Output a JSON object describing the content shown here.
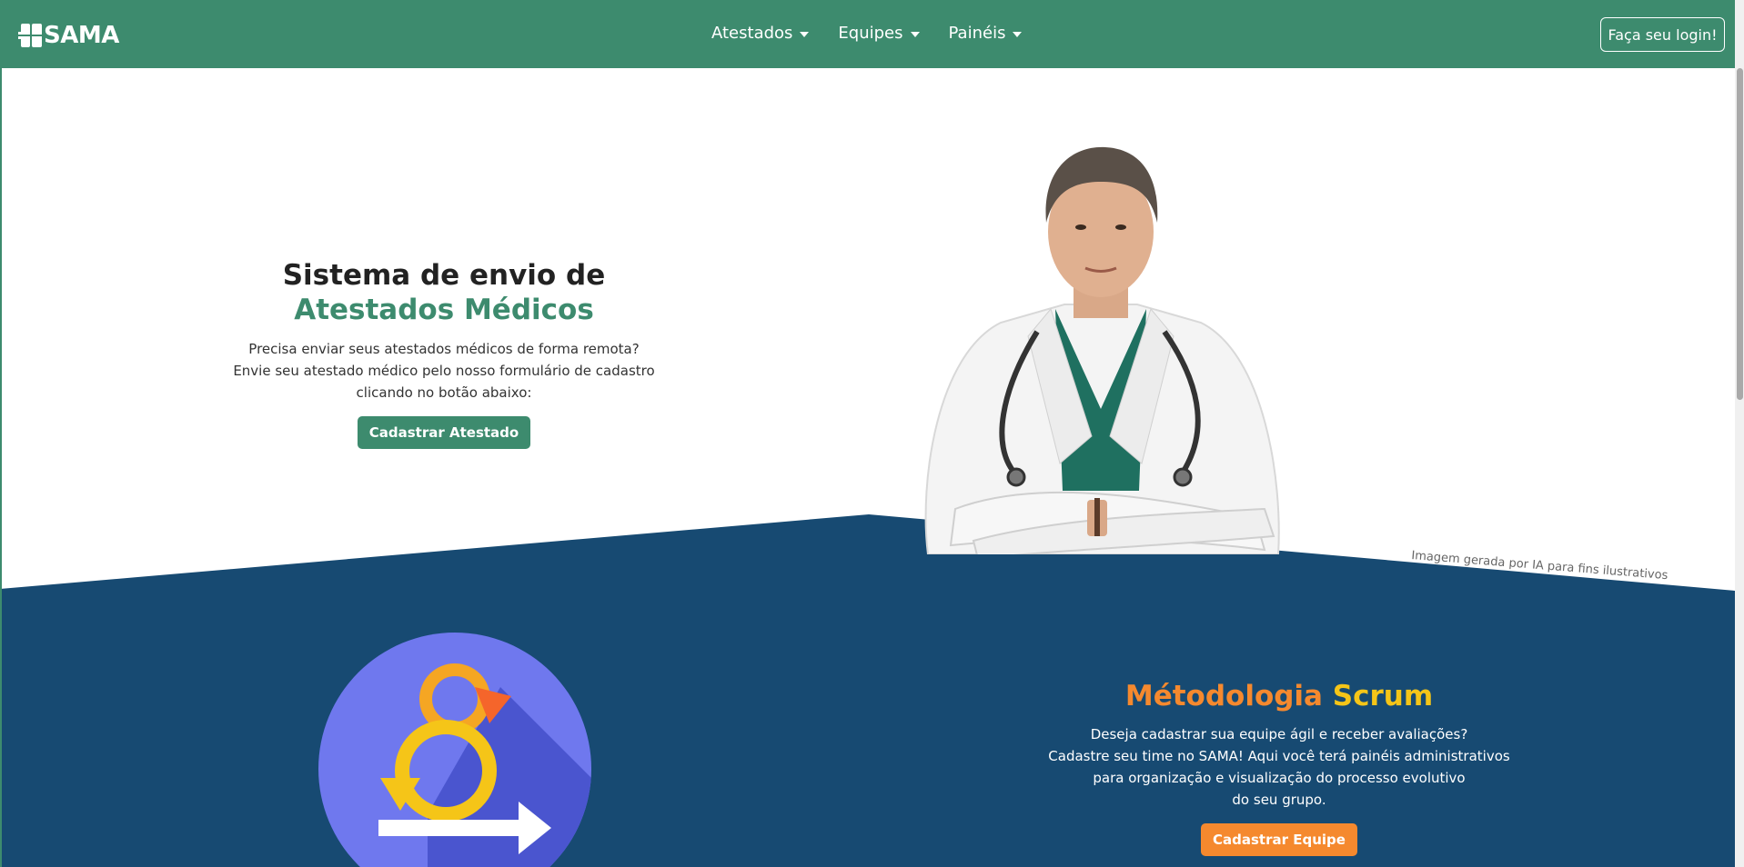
{
  "navbar": {
    "brand": "SAMA",
    "menu": [
      {
        "label": "Atestados"
      },
      {
        "label": "Equipes"
      },
      {
        "label": "Painéis"
      }
    ],
    "login_label": "Faça seu login!"
  },
  "hero": {
    "title_line1": "Sistema de envio de",
    "title_line2": "Atestados Médicos",
    "desc_line1": "Precisa enviar seus atestados médicos de forma remota?",
    "desc_line2": "Envie seu atestado médico pelo nosso formulário de cadastro",
    "desc_line3": "clicando no botão abaixo:",
    "button_label": "Cadastrar Atestado",
    "image_credit": "Imagem gerada por IA para fins ilustrativos"
  },
  "scrum": {
    "title_part1": "Métodologia",
    "title_part2": "Scrum",
    "desc_line1": "Deseja cadastrar sua equipe ágil e receber avaliações?",
    "desc_line2": "Cadastre seu time no SAMA! Aqui você terá painéis administrativos",
    "desc_line3": "para organização e visualização do processo evolutivo",
    "desc_line4": "do seu grupo.",
    "button_label": "Cadastrar Equipe"
  },
  "colors": {
    "primary_green": "#3d8b6e",
    "navy": "#174a72",
    "orange": "#f5892e",
    "yellow": "#f5c518"
  }
}
